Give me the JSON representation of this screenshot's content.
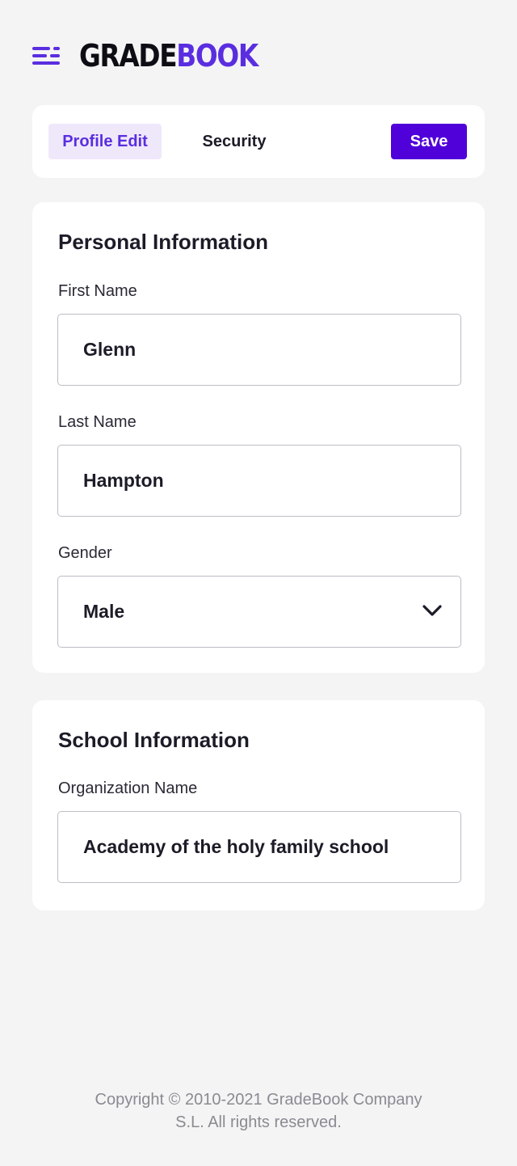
{
  "header": {
    "logo_part1": "GRADE",
    "logo_part2": "BOOK",
    "menu_icon": "hamburger-menu-icon"
  },
  "tabs": {
    "profile_edit": "Profile Edit",
    "security": "Security",
    "save": "Save"
  },
  "personal": {
    "title": "Personal Information",
    "first_name_label": "First Name",
    "first_name_value": "Glenn",
    "last_name_label": "Last Name",
    "last_name_value": "Hampton",
    "gender_label": "Gender",
    "gender_value": "Male",
    "gender_icon": "chevron-down-icon"
  },
  "school": {
    "title": "School Information",
    "org_label": "Organization Name",
    "org_value": "Academy of the holy family school"
  },
  "footer": {
    "line1": "Copyright © 2010-2021 GradeBook Company",
    "line2": "S.L. All rights reserved."
  },
  "colors": {
    "accent": "#5a2ee0",
    "save_button": "#5000d8",
    "active_tab_bg": "#efe8fb",
    "page_bg": "#f4f4f4"
  }
}
